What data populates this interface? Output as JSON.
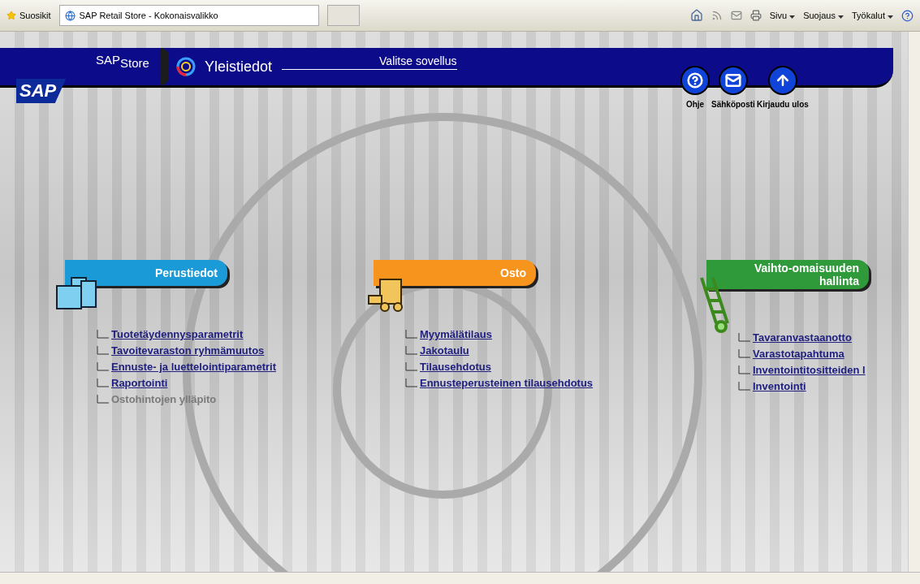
{
  "browser": {
    "favorites": "Suosikit",
    "tab_title": "SAP Retail Store - Kokonaisvalikko",
    "menus": [
      "Sivu",
      "Suojaus",
      "Työkalut"
    ]
  },
  "header": {
    "brand": "SAP",
    "store_logo": "SAP$_{Store}$",
    "title": "Yleistiedot",
    "app_select": "Valitse sovellus",
    "actions": [
      {
        "kind": "help",
        "label": "Ohje"
      },
      {
        "kind": "mail",
        "label": "Sähköposti"
      },
      {
        "kind": "logout",
        "label": "Kirjaudu ulos"
      }
    ]
  },
  "groups": [
    {
      "kind": "folders",
      "color": "#1a9ad6",
      "title": "Perustiedot",
      "links": [
        {
          "label": "Tuotetäydennysparametrit",
          "disabled": false
        },
        {
          "label": "Tavoitevaraston ryhmämuutos",
          "disabled": false
        },
        {
          "label": "Ennuste- ja luettelointiparametrit",
          "disabled": false
        },
        {
          "label": "Raportointi",
          "disabled": false
        },
        {
          "label": "Ostohintojen ylläpito",
          "disabled": true
        }
      ]
    },
    {
      "kind": "truck",
      "color": "#f7941d",
      "title": "Osto",
      "links": [
        {
          "label": "Myymälätilaus",
          "disabled": false
        },
        {
          "label": "Jakotaulu",
          "disabled": false
        },
        {
          "label": "Tilausehdotus",
          "disabled": false
        },
        {
          "label": "Ennusteperusteinen tilausehdotus",
          "disabled": false
        }
      ]
    },
    {
      "kind": "handtruck",
      "color": "#2e9a3a",
      "title": "Vaihto-omaisuuden hallinta",
      "links": [
        {
          "label": "Tavaranvastaanotto",
          "disabled": false
        },
        {
          "label": "Varastotapahtuma",
          "disabled": false
        },
        {
          "label": "Inventointitositteiden l",
          "disabled": false
        },
        {
          "label": "Inventointi",
          "disabled": false
        }
      ]
    }
  ]
}
